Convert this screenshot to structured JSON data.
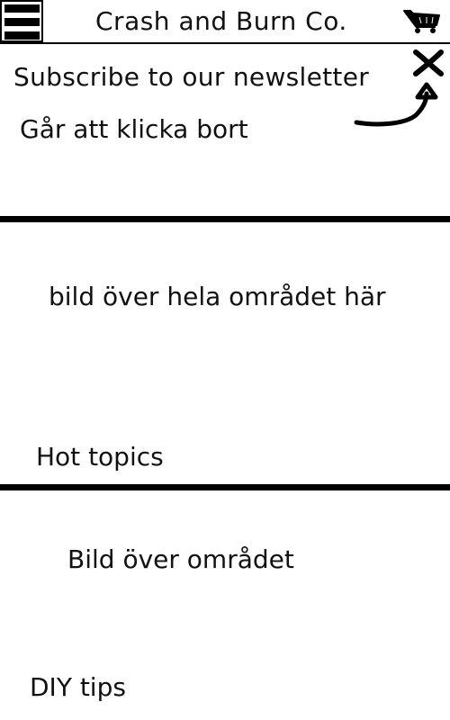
{
  "header": {
    "menu_icon": "hamburger-menu-icon",
    "title": "Crash and Burn Co.",
    "cart_icon": "shopping-cart-icon"
  },
  "newsletter": {
    "title": "Subscribe to our newsletter",
    "subtitle": "Går att klicka bort",
    "close_icon": "close-icon"
  },
  "sections": [
    {
      "image_placeholder": "bild över hela området här",
      "label": "Hot topics"
    },
    {
      "image_placeholder": "Bild över området",
      "label": "DIY tips"
    }
  ]
}
